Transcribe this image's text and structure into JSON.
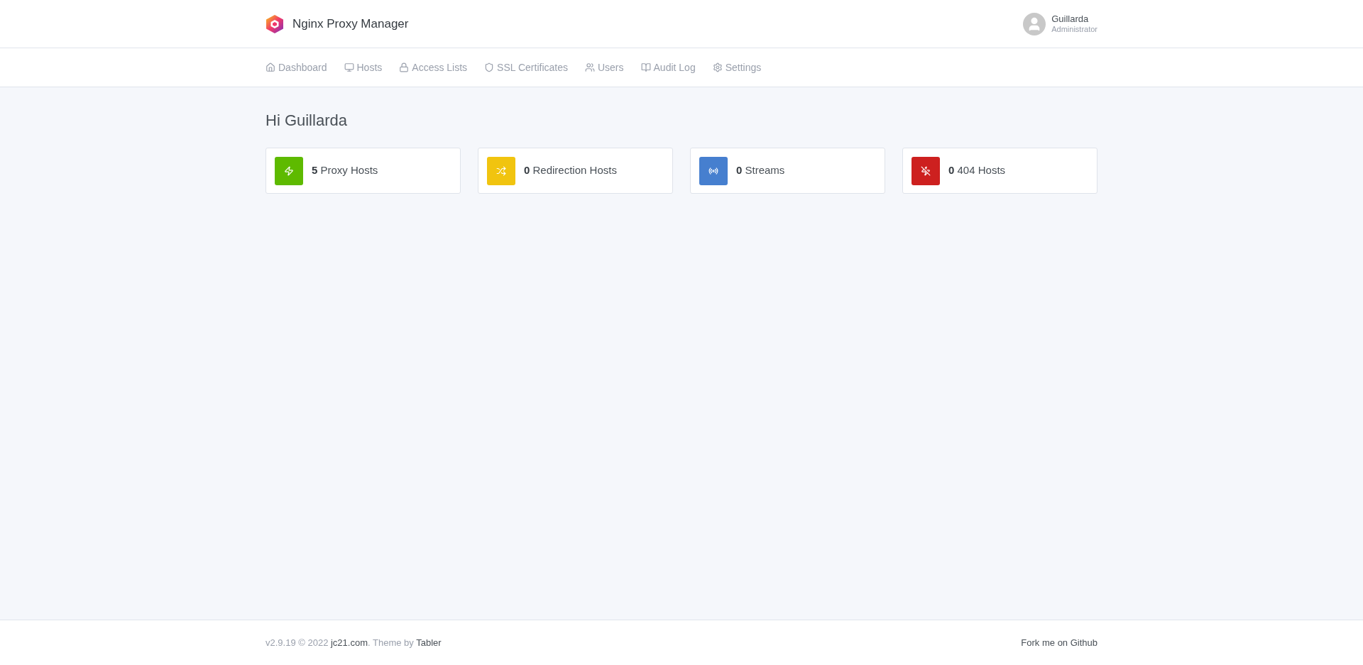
{
  "header": {
    "app_name": "Nginx Proxy Manager",
    "user": {
      "name": "Guillarda",
      "role": "Administrator"
    }
  },
  "nav": [
    {
      "label": "Dashboard",
      "kind": "home"
    },
    {
      "label": "Hosts",
      "kind": "monitor"
    },
    {
      "label": "Access Lists",
      "kind": "lock"
    },
    {
      "label": "SSL Certificates",
      "kind": "shield"
    },
    {
      "label": "Users",
      "kind": "users"
    },
    {
      "label": "Audit Log",
      "kind": "book"
    },
    {
      "label": "Settings",
      "kind": "settings"
    }
  ],
  "greeting": "Hi Guillarda",
  "stats": [
    {
      "count": "5",
      "label": "Proxy Hosts",
      "kind": "zap",
      "color": "#5eba00"
    },
    {
      "count": "0",
      "label": "Redirection Hosts",
      "kind": "shuffle",
      "color": "#f1c40f"
    },
    {
      "count": "0",
      "label": "Streams",
      "kind": "radio",
      "color": "#467fcf"
    },
    {
      "count": "0",
      "label": "404 Hosts",
      "kind": "zapoff",
      "color": "#cd201f"
    }
  ],
  "footer": {
    "version": "v2.9.19 © 2022 ",
    "author_link": "jc21.com",
    "theme_text": ". Theme by ",
    "theme_link": "Tabler",
    "github_link": "Fork me on Github"
  }
}
